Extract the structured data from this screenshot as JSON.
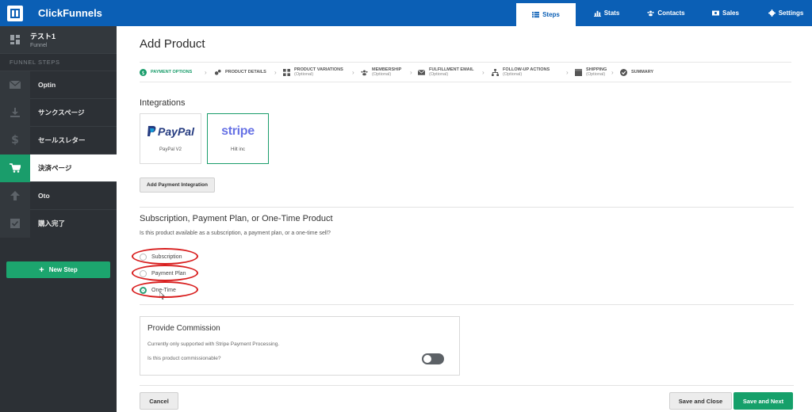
{
  "app": {
    "brand": "ClickFunnels"
  },
  "topnav": [
    {
      "label": "Steps",
      "icon": "list-icon"
    },
    {
      "label": "Stats",
      "icon": "bar-chart-icon"
    },
    {
      "label": "Contacts",
      "icon": "users-icon"
    },
    {
      "label": "Sales",
      "icon": "money-icon"
    },
    {
      "label": "Settings",
      "icon": "gear-icon"
    }
  ],
  "sidebar": {
    "funnel_name": "テスト1",
    "funnel_type": "Funnel",
    "steps_label": "FUNNEL STEPS",
    "steps": [
      {
        "label": "Optin",
        "icon": "envelope-icon"
      },
      {
        "label": "サンクスページ",
        "icon": "download-icon"
      },
      {
        "label": "セールスレター",
        "icon": "dollar-icon"
      },
      {
        "label": "決済ページ",
        "icon": "cart-icon"
      },
      {
        "label": "Oto",
        "icon": "arrow-up-icon"
      },
      {
        "label": "購入完了",
        "icon": "checkbox-icon"
      }
    ],
    "new_step": "New Step"
  },
  "main": {
    "title": "Add Product",
    "wizard": [
      {
        "label": "PAYMENT OPTIONS",
        "optional": ""
      },
      {
        "label": "PRODUCT DETAILS",
        "optional": ""
      },
      {
        "label": "PRODUCT VARIATIONS",
        "optional": "(Optional)"
      },
      {
        "label": "MEMBERSHIP",
        "optional": "(Optional)"
      },
      {
        "label": "FULFILLMENT EMAIL",
        "optional": "(Optional)"
      },
      {
        "label": "FOLLOW-UP ACTIONS",
        "optional": "(Optional)"
      },
      {
        "label": "SHIPPING",
        "optional": "(Optional)"
      },
      {
        "label": "SUMMARY",
        "optional": ""
      }
    ],
    "integrations": {
      "heading": "Integrations",
      "cards": [
        {
          "logo": "PayPal",
          "name": "PayPal V2"
        },
        {
          "logo": "stripe",
          "name": "Hilt inc"
        }
      ],
      "add_button": "Add Payment Integration"
    },
    "product_type": {
      "heading": "Subscription, Payment Plan, or One-Time Product",
      "question": "Is this product available as a subscription, a payment plan, or a one-time sell?",
      "options": [
        "Subscription",
        "Payment Plan",
        "One-Time"
      ],
      "selected": "One-Time"
    },
    "commission": {
      "heading": "Provide Commission",
      "support": "Currently only supported with Stripe Payment Processing.",
      "question": "Is this product commissionable?",
      "enabled": false
    },
    "buttons": {
      "cancel": "Cancel",
      "save_close": "Save and Close",
      "save_next": "Save and Next"
    }
  },
  "colors": {
    "topbar": "#0b5fb5",
    "sidebar": "#2c3035",
    "accent": "#1a9d6b",
    "annotation": "#d81e1e"
  }
}
